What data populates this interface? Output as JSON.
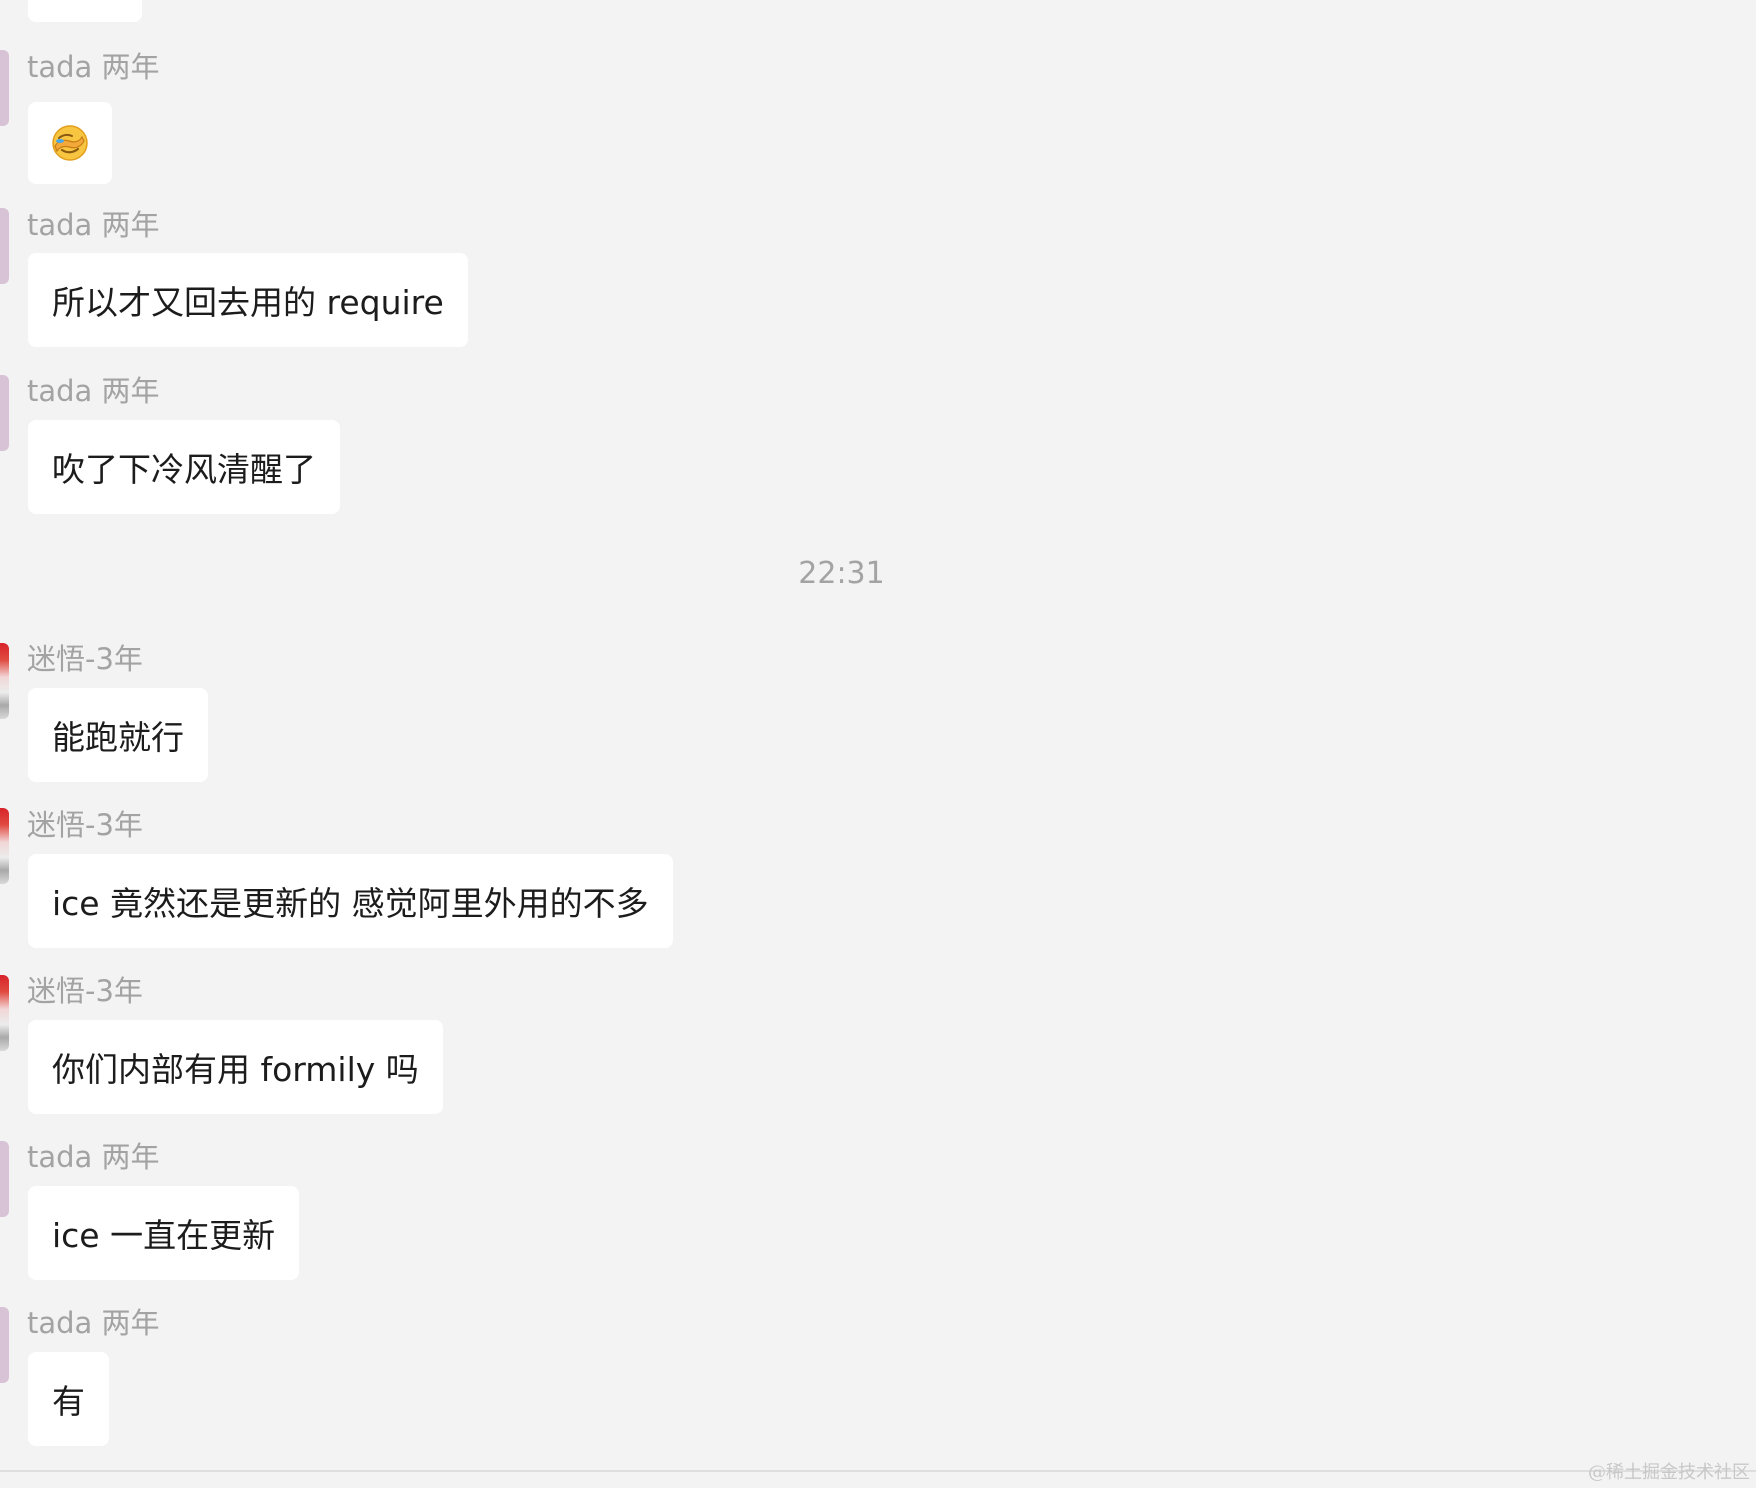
{
  "messages": [
    {
      "sender": "tada 两年",
      "text": "🤦"
    },
    {
      "sender": "tada 两年",
      "text": "所以才又回去用的 require"
    },
    {
      "sender": "tada 两年",
      "text": "吹了下冷风清醒了"
    },
    {
      "sender": "迷悟-3年",
      "text": "能跑就行"
    },
    {
      "sender": "迷悟-3年",
      "text": "ice 竟然还是更新的 感觉阿里外用的不多"
    },
    {
      "sender": "迷悟-3年",
      "text": "你们内部有用 formily 吗"
    },
    {
      "sender": "tada 两年",
      "text": "ice 一直在更新"
    },
    {
      "sender": "tada 两年",
      "text": "有"
    }
  ],
  "timestamp": "22:31",
  "watermark": "@稀土掘金技术社区"
}
